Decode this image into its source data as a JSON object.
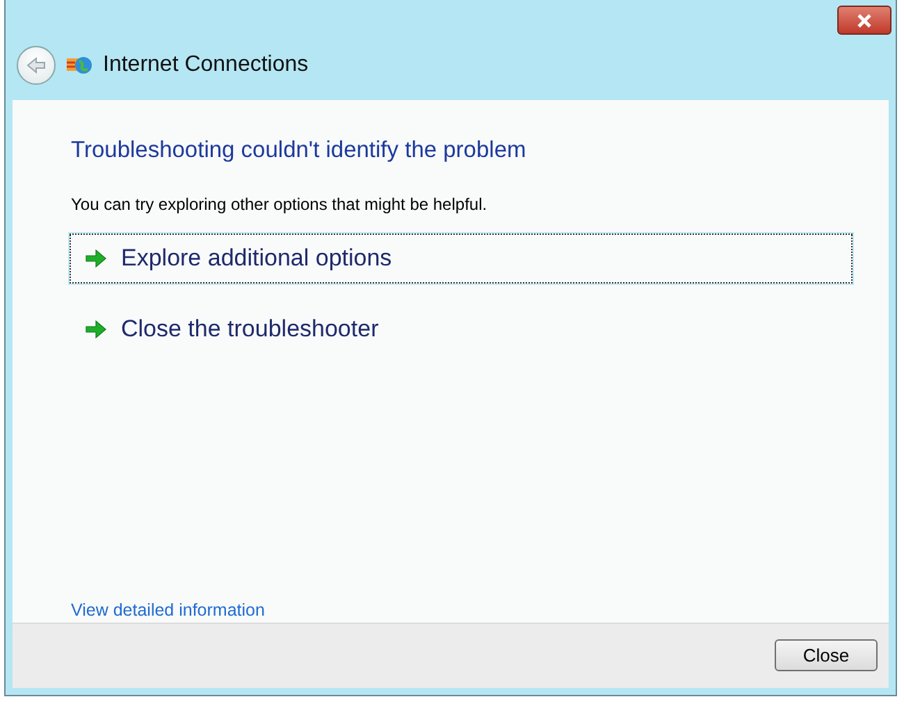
{
  "window": {
    "title": "Internet Connections"
  },
  "heading": "Troubleshooting couldn't identify the problem",
  "message": "You can try exploring other options that might be helpful.",
  "commands": [
    {
      "label": "Explore additional options",
      "focused": true
    },
    {
      "label": "Close the troubleshooter",
      "focused": false
    }
  ],
  "details_link": "View detailed information",
  "buttons": [
    {
      "label": "Close"
    }
  ]
}
